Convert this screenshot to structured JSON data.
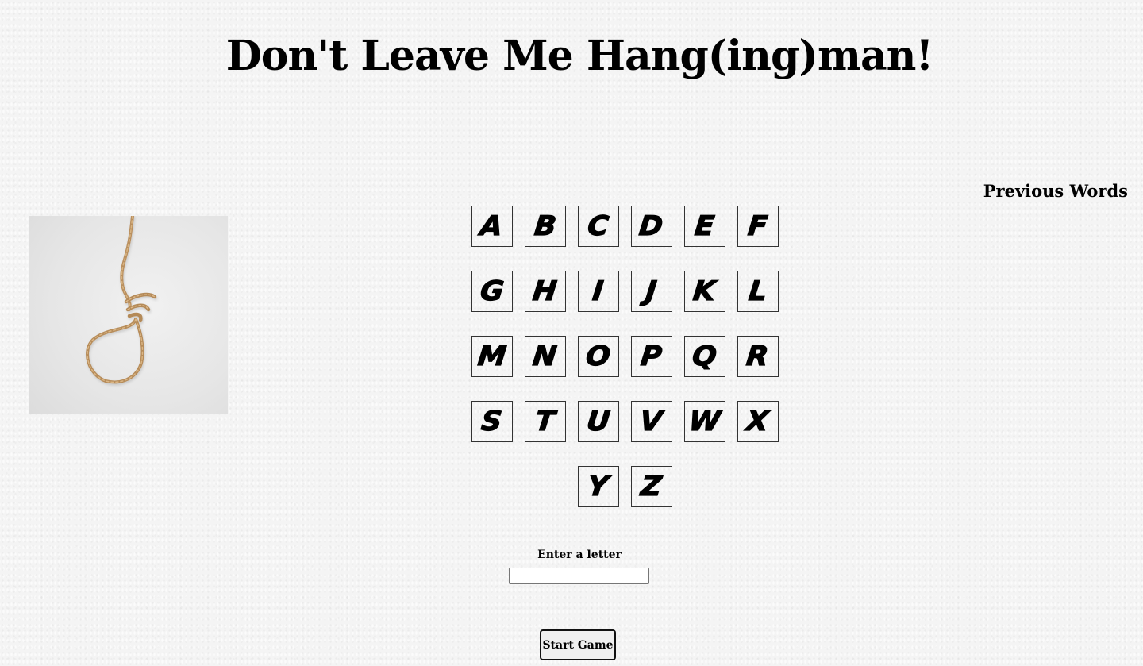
{
  "header": {
    "title": "Don't Leave Me Hang(ing)man!"
  },
  "sidebar": {
    "previous_words_label": "Previous Words"
  },
  "hangman_image": {
    "icon": "noose-rope-icon"
  },
  "alphabet": {
    "rows": [
      [
        "A",
        "B",
        "C",
        "D",
        "E",
        "F"
      ],
      [
        "G",
        "H",
        "I",
        "J",
        "K",
        "L"
      ],
      [
        "M",
        "N",
        "O",
        "P",
        "Q",
        "R"
      ],
      [
        "S",
        "T",
        "U",
        "V",
        "W",
        "X"
      ],
      [
        "Y",
        "Z"
      ]
    ]
  },
  "guess": {
    "label": "Enter a letter",
    "value": "",
    "placeholder": ""
  },
  "controls": {
    "start_label": "Start Game"
  }
}
